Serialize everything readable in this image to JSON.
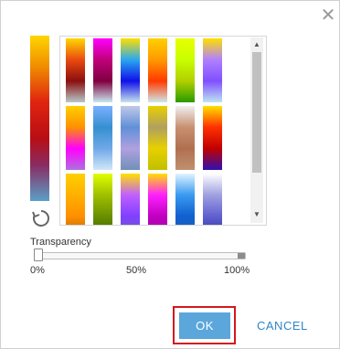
{
  "dialog": {
    "close_icon": "close-icon",
    "preview_ramp_colors": [
      "#ffd500",
      "#f09000",
      "#e02410",
      "#b80e14",
      "#8a2a60",
      "#5aa0c8"
    ],
    "refresh_icon": "refresh-icon",
    "palette": {
      "ramps": [
        [
          "#ffd800",
          "#ea4a10",
          "#8b0f0f",
          "#b7c7c9"
        ],
        [
          "#ff00ff",
          "#c0007a",
          "#800040",
          "#c8e7f0"
        ],
        [
          "#ffe000",
          "#2aa8f0",
          "#1010e8",
          "#c6e4ee"
        ],
        [
          "#ffd000",
          "#ff9a00",
          "#ff3a00",
          "#cee8ea"
        ],
        [
          "#e8ff00",
          "#c8ff00",
          "#b2d000",
          "#2a9a00"
        ],
        [
          "#ffe000",
          "#b080ff",
          "#8050ff",
          "#bde4f2"
        ],
        [
          "#ffd000",
          "#ff9000",
          "#ff00ff",
          "#b070e0"
        ],
        [
          "#7bb0ff",
          "#3590d0",
          "#70a8e8",
          "#d0e8f8"
        ],
        [
          "#c0c8e8",
          "#6090d8",
          "#b0a0e0",
          "#7090b8"
        ],
        [
          "#e8d000",
          "#b0a060",
          "#e8d000",
          "#c0c000"
        ],
        [
          "#f0f0f0",
          "#c89070",
          "#b07050",
          "#c09070"
        ],
        [
          "#ffe000",
          "#ff3000",
          "#c00000",
          "#3010b0"
        ],
        [
          "#ffd000",
          "#ffb000",
          "#ff9000",
          "#b06000"
        ],
        [
          "#e0ff00",
          "#a0c000",
          "#6a9000",
          "#3a6000"
        ],
        [
          "#ffe000",
          "#c060ff",
          "#8040ff",
          "#7060c0"
        ],
        [
          "#ffe000",
          "#ff20ff",
          "#c000c0",
          "#a000a0"
        ],
        [
          "#dff4ff",
          "#3a9af0",
          "#1060d0",
          "#2060b0"
        ],
        [
          "#ffffff",
          "#a0a0e0",
          "#6060d0",
          "#3030a0"
        ]
      ]
    },
    "scroll_up_icon": "chevron-up-icon",
    "scroll_down_icon": "chevron-down-icon",
    "transparency": {
      "label": "Transparency",
      "value_percent": 0,
      "tick_0": "0%",
      "tick_50": "50%",
      "tick_100": "100%"
    },
    "buttons": {
      "ok": "OK",
      "cancel": "CANCEL"
    }
  }
}
